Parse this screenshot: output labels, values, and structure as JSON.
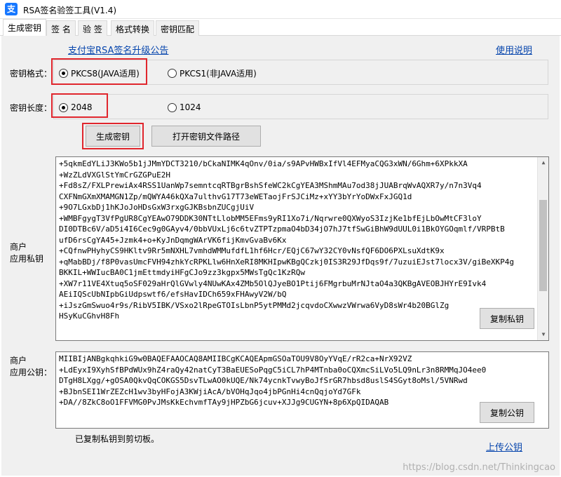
{
  "window": {
    "title": "RSA签名验签工具(V1.4)",
    "icon": "alipay-icon",
    "icon_glyph": "支"
  },
  "tabs": [
    {
      "label": "生成密钥",
      "active": true
    },
    {
      "label": "签 名",
      "active": false
    },
    {
      "label": "验 签",
      "active": false
    },
    {
      "label": "格式转换",
      "active": false
    },
    {
      "label": "密钥匹配",
      "active": false
    }
  ],
  "links": {
    "announcement": "支付宝RSA签名升级公告",
    "help": "使用说明",
    "upload": "上传公钥"
  },
  "key_format": {
    "label": "密钥格式：",
    "options": [
      {
        "label": "PKCS8(JAVA适用)",
        "checked": true
      },
      {
        "label": "PKCS1(非JAVA适用)",
        "checked": false
      }
    ]
  },
  "key_length": {
    "label": "密钥长度：",
    "options": [
      {
        "label": "2048",
        "checked": true
      },
      {
        "label": "1024",
        "checked": false
      }
    ]
  },
  "buttons": {
    "generate": "生成密钥",
    "open_path": "打开密钥文件路径",
    "copy_private": "复制私钥",
    "copy_public": "复制公钥"
  },
  "private_key": {
    "label_line1": "商户",
    "label_line2": "应用私钥",
    "lines": [
      "+5qkmEdYLiJ3KWo5b1jJMmYDCT3210/bCkaNIMK4qOnv/0ia/s9APvHWBxIfVl4EFMyaCQG3xWN/6Ghm+6XPkkXA",
      "+WzZLdVXGlStYmCrGZGPuE2H",
      "+Fd8sZ/FXLPrewiAx4RSS1UanWp7semntcqRTBgrBshSfeWC2kCgYEA3MShmMAu7od38jJUABrqWvAQXR7y/n7n3Vq4",
      "CXFNmGXmXMAMGN1Zp/mQWYA46kQXa7ulthvG17T73eWETaojFrSJCiMz+xYY3bYrYoDWxFxJGQ1d",
      "+9O7LGxbDj1hKJoJoHDsGxW3rxgGJKBsbnZUCgjUiV",
      "+WMBFgygT3VfPgUR8CgYEAwO79DDK30NTtLlobMM5EFms9yRI1Xo7i/Nqrwre0QXWyoS3IzjKe1bfEjLbOwMtCF3loY",
      "DI0DTBc6V/aD5i4I6Cec9g0GAyv4/0bbVUxLj6c6tvZTPTzpmaO4bD34jO7hJ7tfSwGiBhW9dUUL0i1BkOYGOqmlf/VRPBtB",
      "ufD6rsCgYA45+Jzmk4+o+KyJnDqmgWArVK6fijKmvGvaBv6Kx",
      "+CQfnwPHyhyCS9HKltv9Rr5mNXHL7vmhdWMMufdfL1hf6Hcr/EQjC67wY32CY0vNsfQF6DO6PXLsuXdtK9x",
      "+qMabBDj/f8P0vasUmcFVH94zhkYcRPKLlw6HnXeRI8MKHIpwKBgQCzkj0IS3R29JfDqs9f/7uzuiEJst7locx3V/giBeXKP4g",
      "BKKIL+WWIucBA0C1jmEttmdyiHFgCJo9zz3kgpx5MWsTgQc1KzRQw",
      "+XW7r11VE4Xtuq5oSF029aHrQlGVwly4NUwKAx4ZMb5OlQJyeBO1Ptij6FMgrbuMrNJtaO4a3QKBgAVEOBJHYrE9Ivk4",
      "AEiIQScUbNIpbGiUdpswtf6/efsHavIDCh659xFHAwyV2W/bQ",
      "+iJszGmSwuo4r9s/RibV5IBK/VSxo2lRpeGTOIsLbnP5ytPMMd2jcqvdoCXwwzVWrwa6VyD8sWr4b20BGlZg",
      "HSyKuCGhvH8Fh"
    ],
    "scroll_position": 0.45
  },
  "public_key": {
    "label_line1": "商户",
    "label_line2": "应用公钥：",
    "lines": [
      "MIIBIjANBgkqhkiG9w0BAQEFAAOCAQ8AMIIBCgKCAQEApmGSOaTOU9V8OyYVqE/rR2ca+NrX92VZ",
      "+LdEyxI9XyhSfBPdWUx9hZ4raQy42natCyT3BaEUESoPqgC5iCL7hP4MTnba0oCQXmcSiLVo5LQ9nLr3n8RMMqJO4ee0",
      "DTgH8LXgg/+gOSA0QkvQqCOKGS5DsvTLwAO0kUQE/Nk74ycnkTvwyBoJfSrGR7hbsd8uslS4SGyt8oMsl/5VNRwd",
      "+BJbnSEI1WrZEZcH1wv3byHFojA3KWjiAcA/bVOHqJqo4jbPGnHi4cnQqjoYd7GFk",
      "+DA//8ZkC8oO1FFVMG0PvJMsKkEchvmfTAy9jHPZbG6jcuv+XJJg9CUGYN+8p6XpQIDAQAB"
    ]
  },
  "status": "已复制私钥到剪切板。",
  "watermark": "https://blog.csdn.net/Thinkingcao",
  "colors": {
    "highlight": "#e0262d",
    "link": "#0645ad",
    "panel": "#f0f0f0"
  }
}
